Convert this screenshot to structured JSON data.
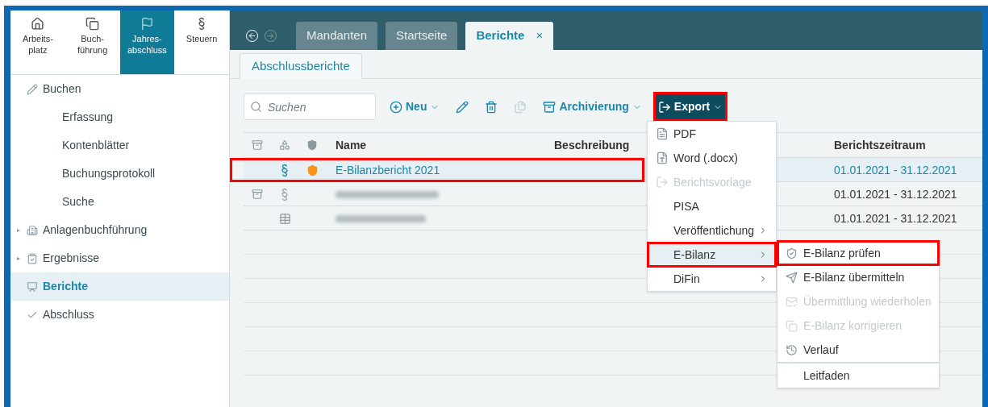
{
  "nav": [
    {
      "lines": [
        "Arbeits-",
        "platz"
      ],
      "selected": false
    },
    {
      "lines": [
        "Buch-",
        "führung"
      ],
      "selected": false
    },
    {
      "lines": [
        "Jahres-",
        "abschluss"
      ],
      "selected": true
    },
    {
      "lines": [
        "Steuern"
      ],
      "selected": false
    }
  ],
  "sidebar": {
    "items": [
      {
        "label": "Buchen",
        "selected": false,
        "children": [
          {
            "label": "Erfassung",
            "selected": false
          },
          {
            "label": "Kontenblätter",
            "selected": false
          },
          {
            "label": "Buchungsprotokoll",
            "selected": false
          },
          {
            "label": "Suche",
            "selected": false
          }
        ]
      },
      {
        "label": "Anlagenbuchführung",
        "selected": false,
        "toggle": "▸"
      },
      {
        "label": "Ergebnisse",
        "selected": false,
        "toggle": "▸"
      },
      {
        "label": "Berichte",
        "selected": true
      },
      {
        "label": "Abschluss",
        "selected": false
      }
    ]
  },
  "tabs": [
    {
      "label": "Mandanten",
      "selected": false
    },
    {
      "label": "Startseite",
      "selected": false
    },
    {
      "label": "Berichte",
      "selected": true,
      "close": "×"
    }
  ],
  "subtabs": [
    {
      "label": "Abschlussberichte",
      "selected": true
    }
  ],
  "toolbar": {
    "search": {
      "placeholder": "Suchen"
    },
    "items": [
      {
        "kind": "menu",
        "label": "Neu",
        "disabled": false,
        "active": false,
        "highlighted": false
      },
      {
        "kind": "icon",
        "disabled": false,
        "active": false,
        "highlighted": false
      },
      {
        "kind": "icon",
        "disabled": false,
        "active": false,
        "highlighted": false
      },
      {
        "kind": "icon",
        "disabled": true,
        "active": false,
        "highlighted": false
      },
      {
        "kind": "menu",
        "label": "Archivierung",
        "disabled": false,
        "active": false,
        "highlighted": false
      },
      {
        "kind": "menu",
        "label": "Export",
        "disabled": false,
        "active": true,
        "highlighted": true
      }
    ]
  },
  "table": {
    "columns": [
      "Name",
      "Beschreibung",
      "Berichtszeitraum"
    ],
    "rows": [
      {
        "kind": "tax",
        "name": "E-Bilanzbericht 2021",
        "redacted": false,
        "archived": false,
        "warning": true,
        "period": "01.01.2021 - 31.12.2021",
        "selected": true,
        "highlighted": true
      },
      {
        "kind": "tax",
        "redacted": true,
        "archived": true,
        "warning": false,
        "period": "01.01.2021 - 31.12.2021",
        "selected": false,
        "highlighted": false
      },
      {
        "kind": "table",
        "redacted": true,
        "archived": false,
        "warning": false,
        "period": "01.01.2021 - 31.12.2021",
        "selected": false,
        "highlighted": false
      }
    ]
  },
  "export_menu": [
    {
      "label": "PDF",
      "disabled": false,
      "submenu": false,
      "selected": false,
      "highlighted": false
    },
    {
      "label": "Word (.docx)",
      "disabled": false,
      "submenu": false,
      "selected": false,
      "highlighted": false
    },
    {
      "label": "Berichtsvorlage",
      "disabled": true,
      "submenu": false,
      "selected": false,
      "highlighted": false
    },
    {
      "label": "PISA",
      "disabled": false,
      "submenu": false,
      "selected": false,
      "highlighted": false
    },
    {
      "label": "Veröffentlichung",
      "disabled": false,
      "submenu": true,
      "selected": false,
      "highlighted": false
    },
    {
      "label": "E-Bilanz",
      "disabled": false,
      "submenu": true,
      "selected": true,
      "highlighted": true
    },
    {
      "label": "DiFin",
      "disabled": false,
      "submenu": true,
      "selected": false,
      "highlighted": false
    }
  ],
  "ebilanz_menu": [
    {
      "label": "E-Bilanz prüfen",
      "disabled": false,
      "separator_before": false,
      "highlighted": true
    },
    {
      "label": "E-Bilanz übermitteln",
      "disabled": false,
      "separator_before": false,
      "highlighted": false
    },
    {
      "label": "Übermittlung wiederholen",
      "disabled": true,
      "separator_before": false,
      "highlighted": false
    },
    {
      "label": "E-Bilanz korrigieren",
      "disabled": true,
      "separator_before": false,
      "highlighted": false
    },
    {
      "label": "Verlauf",
      "disabled": false,
      "separator_before": false,
      "highlighted": false
    },
    {
      "label": "Leitfaden",
      "disabled": false,
      "separator_before": true,
      "highlighted": false
    }
  ]
}
